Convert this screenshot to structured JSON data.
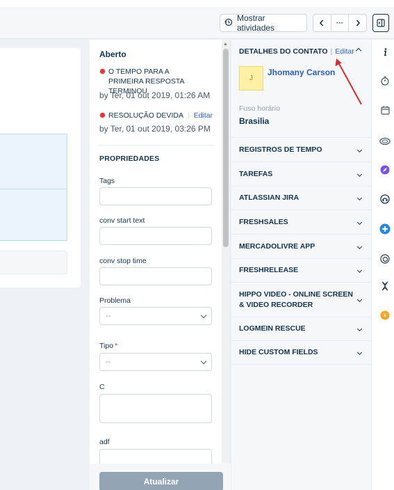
{
  "toolbar": {
    "activities_label": "Mostrar atividades",
    "prev": "‹",
    "more": "···",
    "next": "›"
  },
  "ticket": {
    "status": "Aberto",
    "sla": [
      {
        "label": "O tempo para a primeira resposta terminou",
        "due": "by Ter, 01 out 2019, 01:26 AM",
        "edit": ""
      },
      {
        "label": "Resolução devida",
        "due": "by Ter, 01 out 2019, 03:26 PM",
        "edit": "Editar"
      }
    ]
  },
  "properties": {
    "title": "PROPRIEDADES",
    "fields": {
      "tags": "Tags",
      "conv_start": "conv start text",
      "conv_stop": "conv stop time",
      "problema": "Problema",
      "tipo": "Tipo",
      "c": "C",
      "adf": "adf"
    },
    "select_placeholder": "--",
    "required_mark": "*",
    "update_label": "Atualizar"
  },
  "contact": {
    "header": "Detalhes do contato",
    "separator": "|",
    "edit": "Editar",
    "avatar_initial": "J",
    "name": "Jhomany Carson",
    "timezone_label": "Fuso horário",
    "timezone_value": "Brasilia"
  },
  "sections": [
    "Registros de tempo",
    "Tarefas",
    "Atlassian Jira",
    "Freshsales",
    "MercadoLivre App",
    "Freshrelease",
    "Hippo Video - Online Screen & Video Recorder",
    "LogMeIn Rescue",
    "Hide Custom Fields"
  ],
  "rail_icons": [
    "info-icon",
    "timer-icon",
    "calendar-icon",
    "eye-icon",
    "rocket-icon",
    "headset-icon",
    "plus-circle-icon",
    "spiral-icon",
    "dna-icon",
    "bolt-icon"
  ],
  "colors": {
    "accent": "#2c5cc5",
    "overdue": "#e43538",
    "annotation": "#e02a2a"
  }
}
